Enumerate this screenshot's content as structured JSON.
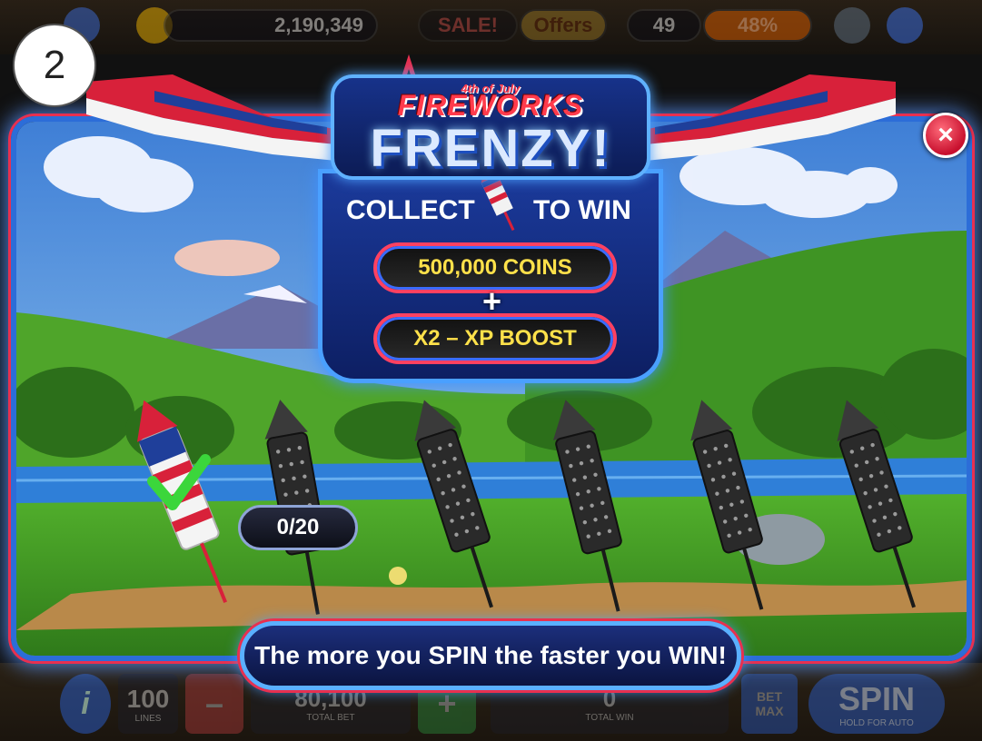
{
  "hud": {
    "coins": "2,190,349",
    "sale_label": "SALE!",
    "offers_label": "Offers",
    "level": "49",
    "xp_percent": "48%"
  },
  "controls": {
    "info_label": "i",
    "lines_value": "100",
    "lines_label": "LINES",
    "minus_label": "–",
    "total_bet_value": "80,100",
    "total_bet_label": "TOTAL BET",
    "plus_label": "+",
    "total_win_value": "0",
    "total_win_label": "TOTAL WIN",
    "bet_max_line1": "BET",
    "bet_max_line2": "MAX",
    "spin_label": "SPIN",
    "spin_hint": "HOLD FOR AUTO"
  },
  "step_badge": "2",
  "popup": {
    "subtitle": "4th of July",
    "title_line1": "FIREWORKS",
    "title_line2": "FRENZY!",
    "collect_prefix": "COLLECT",
    "collect_suffix": "TO WIN",
    "prize_1": "500,000 COINS",
    "plus": "+",
    "prize_2": "X2 – XP BOOST",
    "progress": "0/20",
    "progress_value": 0,
    "progress_total": 20,
    "rockets_total": 6,
    "rockets_completed": 1,
    "footer": "The more you SPIN the faster you WIN!",
    "close_symbol": "×"
  },
  "colors": {
    "frame_blue": "#2c6dd8",
    "frame_red": "#e83050",
    "prize_text": "#ffe14a",
    "check_green": "#3bd63b"
  }
}
